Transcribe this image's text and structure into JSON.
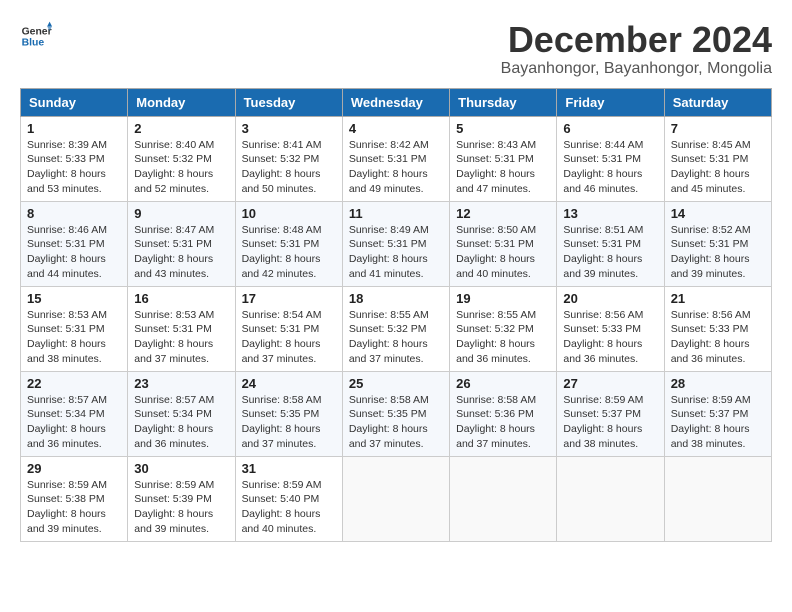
{
  "header": {
    "logo_line1": "General",
    "logo_line2": "Blue",
    "month": "December 2024",
    "location": "Bayanhongor, Bayanhongor, Mongolia"
  },
  "weekdays": [
    "Sunday",
    "Monday",
    "Tuesday",
    "Wednesday",
    "Thursday",
    "Friday",
    "Saturday"
  ],
  "weeks": [
    [
      {
        "day": "1",
        "sunrise": "8:39 AM",
        "sunset": "5:33 PM",
        "daylight": "8 hours and 53 minutes."
      },
      {
        "day": "2",
        "sunrise": "8:40 AM",
        "sunset": "5:32 PM",
        "daylight": "8 hours and 52 minutes."
      },
      {
        "day": "3",
        "sunrise": "8:41 AM",
        "sunset": "5:32 PM",
        "daylight": "8 hours and 50 minutes."
      },
      {
        "day": "4",
        "sunrise": "8:42 AM",
        "sunset": "5:31 PM",
        "daylight": "8 hours and 49 minutes."
      },
      {
        "day": "5",
        "sunrise": "8:43 AM",
        "sunset": "5:31 PM",
        "daylight": "8 hours and 47 minutes."
      },
      {
        "day": "6",
        "sunrise": "8:44 AM",
        "sunset": "5:31 PM",
        "daylight": "8 hours and 46 minutes."
      },
      {
        "day": "7",
        "sunrise": "8:45 AM",
        "sunset": "5:31 PM",
        "daylight": "8 hours and 45 minutes."
      }
    ],
    [
      {
        "day": "8",
        "sunrise": "8:46 AM",
        "sunset": "5:31 PM",
        "daylight": "8 hours and 44 minutes."
      },
      {
        "day": "9",
        "sunrise": "8:47 AM",
        "sunset": "5:31 PM",
        "daylight": "8 hours and 43 minutes."
      },
      {
        "day": "10",
        "sunrise": "8:48 AM",
        "sunset": "5:31 PM",
        "daylight": "8 hours and 42 minutes."
      },
      {
        "day": "11",
        "sunrise": "8:49 AM",
        "sunset": "5:31 PM",
        "daylight": "8 hours and 41 minutes."
      },
      {
        "day": "12",
        "sunrise": "8:50 AM",
        "sunset": "5:31 PM",
        "daylight": "8 hours and 40 minutes."
      },
      {
        "day": "13",
        "sunrise": "8:51 AM",
        "sunset": "5:31 PM",
        "daylight": "8 hours and 39 minutes."
      },
      {
        "day": "14",
        "sunrise": "8:52 AM",
        "sunset": "5:31 PM",
        "daylight": "8 hours and 39 minutes."
      }
    ],
    [
      {
        "day": "15",
        "sunrise": "8:53 AM",
        "sunset": "5:31 PM",
        "daylight": "8 hours and 38 minutes."
      },
      {
        "day": "16",
        "sunrise": "8:53 AM",
        "sunset": "5:31 PM",
        "daylight": "8 hours and 37 minutes."
      },
      {
        "day": "17",
        "sunrise": "8:54 AM",
        "sunset": "5:31 PM",
        "daylight": "8 hours and 37 minutes."
      },
      {
        "day": "18",
        "sunrise": "8:55 AM",
        "sunset": "5:32 PM",
        "daylight": "8 hours and 37 minutes."
      },
      {
        "day": "19",
        "sunrise": "8:55 AM",
        "sunset": "5:32 PM",
        "daylight": "8 hours and 36 minutes."
      },
      {
        "day": "20",
        "sunrise": "8:56 AM",
        "sunset": "5:33 PM",
        "daylight": "8 hours and 36 minutes."
      },
      {
        "day": "21",
        "sunrise": "8:56 AM",
        "sunset": "5:33 PM",
        "daylight": "8 hours and 36 minutes."
      }
    ],
    [
      {
        "day": "22",
        "sunrise": "8:57 AM",
        "sunset": "5:34 PM",
        "daylight": "8 hours and 36 minutes."
      },
      {
        "day": "23",
        "sunrise": "8:57 AM",
        "sunset": "5:34 PM",
        "daylight": "8 hours and 36 minutes."
      },
      {
        "day": "24",
        "sunrise": "8:58 AM",
        "sunset": "5:35 PM",
        "daylight": "8 hours and 37 minutes."
      },
      {
        "day": "25",
        "sunrise": "8:58 AM",
        "sunset": "5:35 PM",
        "daylight": "8 hours and 37 minutes."
      },
      {
        "day": "26",
        "sunrise": "8:58 AM",
        "sunset": "5:36 PM",
        "daylight": "8 hours and 37 minutes."
      },
      {
        "day": "27",
        "sunrise": "8:59 AM",
        "sunset": "5:37 PM",
        "daylight": "8 hours and 38 minutes."
      },
      {
        "day": "28",
        "sunrise": "8:59 AM",
        "sunset": "5:37 PM",
        "daylight": "8 hours and 38 minutes."
      }
    ],
    [
      {
        "day": "29",
        "sunrise": "8:59 AM",
        "sunset": "5:38 PM",
        "daylight": "8 hours and 39 minutes."
      },
      {
        "day": "30",
        "sunrise": "8:59 AM",
        "sunset": "5:39 PM",
        "daylight": "8 hours and 39 minutes."
      },
      {
        "day": "31",
        "sunrise": "8:59 AM",
        "sunset": "5:40 PM",
        "daylight": "8 hours and 40 minutes."
      },
      null,
      null,
      null,
      null
    ]
  ],
  "labels": {
    "sunrise": "Sunrise:",
    "sunset": "Sunset:",
    "daylight": "Daylight:"
  }
}
